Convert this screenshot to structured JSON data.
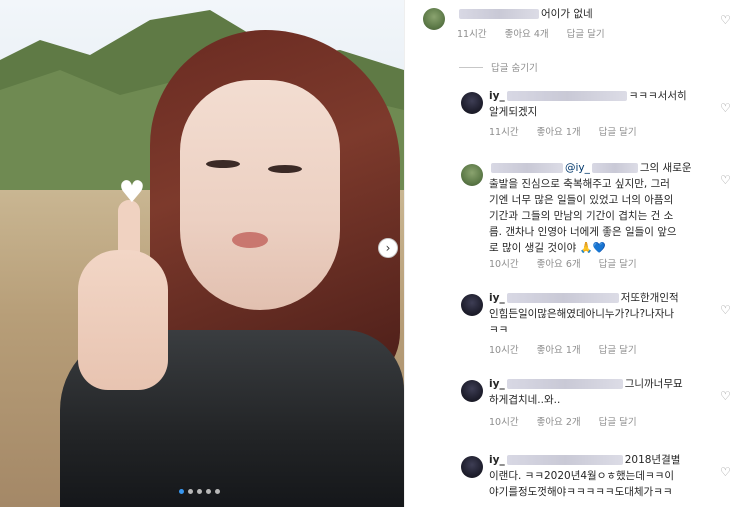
{
  "comments": [
    {
      "text": "어이가 없네",
      "time": "11시간",
      "likes": "좋아요 4개",
      "reply": "답글 달기"
    },
    {
      "reply_toggle": "답글 숨기기"
    },
    {
      "user": "iy_",
      "text_line1": "ㅋㅋㅋ서서히",
      "text_line2": "알게되겠지",
      "time": "11시간",
      "likes": "좋아요 1개",
      "reply": "답글 달기"
    },
    {
      "mention": "@iy_",
      "text_line1": "그의 새로운",
      "text_line2": "출발을 진심으로 축복해주고 싶지만, 그러",
      "text_line3": "기엔 너무 많은 일들이 있었고 너의 아픔의",
      "text_line4": "기간과 그들의 만남의 기간이 겹치는 건 소",
      "text_line5": "름. 갠차나 인영아 너에게 좋은 일들이 앞으",
      "text_line6": "로 많이 생길 것이야",
      "emoji1": "🙏",
      "emoji2": "💙",
      "time": "10시간",
      "likes": "좋아요 6개",
      "reply": "답글 달기"
    },
    {
      "user": "iy_",
      "text_line1": "저또한개인적",
      "text_line2": "인힘든일이많은해였데아니누가?나?나자나",
      "text_line3": "ㅋㅋ",
      "time": "10시간",
      "likes": "좋아요 1개",
      "reply": "답글 달기"
    },
    {
      "user": "iy_",
      "text_line1": "그니까너무묘",
      "text_line2": "하게겹치네..와..",
      "time": "10시간",
      "likes": "좋아요 2개",
      "reply": "답글 달기"
    },
    {
      "user": "iy_",
      "text_line1": "2018년결별",
      "text_line2": "이랜다. ㅋㅋ2020년4월ㅇㅎ했는데ㅋㅋ이",
      "text_line3": "야기를정도껏해야ㅋㅋㅋㅋㅋ도대체가ㅋㅋ"
    }
  ],
  "colors": {
    "text": "#262626",
    "meta": "#8e8e8e",
    "accent": "#3897f0"
  },
  "icons": {
    "like": "heart-outline-icon",
    "next": "chevron-right-icon",
    "photo_heart": "white-heart-icon"
  }
}
